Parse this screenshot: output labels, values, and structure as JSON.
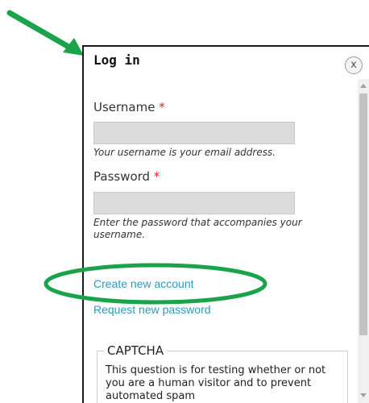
{
  "dialog": {
    "title": "Log in",
    "close_symbol": "x"
  },
  "form": {
    "username_label": "Username",
    "username_required": "*",
    "username_value": "",
    "username_description": "Your username is your email address.",
    "password_label": "Password",
    "password_required": "*",
    "password_value": "",
    "password_description": "Enter the password that accompanies your username."
  },
  "links": {
    "create_account": "Create new account",
    "request_password": "Request new password"
  },
  "captcha": {
    "legend": "CAPTCHA",
    "description": "This question is for testing whether or not you are a human visitor and to prevent automated spam"
  },
  "annotations": {
    "arrow_color": "#1aa34a",
    "ellipse_color": "#1aa34a",
    "arrow_icon": "arrow-icon",
    "highlight_icon": "ellipse-highlight"
  }
}
